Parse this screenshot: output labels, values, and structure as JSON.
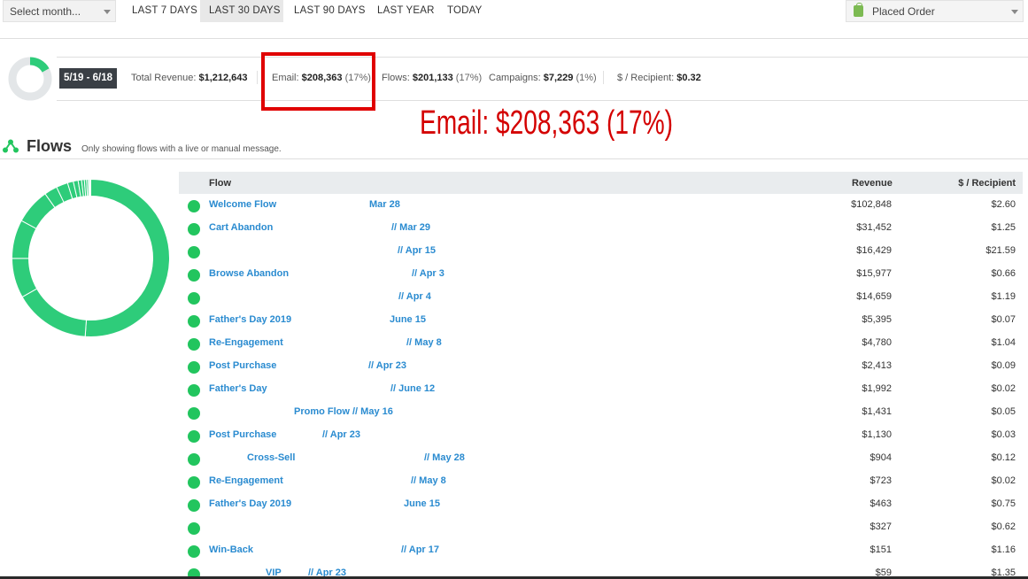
{
  "toolbar": {
    "month_select": "Select month...",
    "ranges": [
      "LAST 7 DAYS",
      "LAST 30 DAYS",
      "LAST 90 DAYS",
      "LAST YEAR",
      "TODAY"
    ],
    "active_range": "LAST 30 DAYS",
    "metric_select": "Placed Order"
  },
  "summary": {
    "date_range": "5/19 - 6/18",
    "total_revenue_label": "Total Revenue:",
    "total_revenue": "$1,212,643",
    "email_label": "Email:",
    "email_value": "$208,363",
    "email_pct": "(17%)",
    "flows_label": "Flows:",
    "flows_value": "$201,133",
    "flows_pct": "(17%)",
    "campaigns_label": "Campaigns:",
    "campaigns_value": "$7,229",
    "campaigns_pct": "(1%)",
    "per_recipient_label": "$ / Recipient:",
    "per_recipient_value": "$0.32",
    "email_share_fraction": 0.17
  },
  "annotation": {
    "text": "Email: $208,363 (17%)",
    "color": "#d40000"
  },
  "flows": {
    "title": "Flows",
    "subtitle": "Only showing flows with a live or manual message.",
    "columns": {
      "flow": "Flow",
      "revenue": "Revenue",
      "per_recipient": "$ / Recipient"
    },
    "accent": "#22c55e",
    "link_color": "#2a8bd0",
    "rows": [
      {
        "name": "Welcome Flow",
        "date": "Mar 28",
        "revenue": "$102,848",
        "per_recipient": "$2.60"
      },
      {
        "name": "Cart Abandon",
        "date": "// Mar 29",
        "revenue": "$31,452",
        "per_recipient": "$1.25"
      },
      {
        "name": "",
        "date": "// Apr 15",
        "revenue": "$16,429",
        "per_recipient": "$21.59"
      },
      {
        "name": "Browse Abandon",
        "date": "// Apr 3",
        "revenue": "$15,977",
        "per_recipient": "$0.66"
      },
      {
        "name": "",
        "date": "// Apr 4",
        "revenue": "$14,659",
        "per_recipient": "$1.19"
      },
      {
        "name": "Father's Day 2019",
        "date": "June 15",
        "revenue": "$5,395",
        "per_recipient": "$0.07"
      },
      {
        "name": "Re-Engagement",
        "date": "// May 8",
        "revenue": "$4,780",
        "per_recipient": "$1.04"
      },
      {
        "name": "Post Purchase",
        "date": "// Apr 23",
        "revenue": "$2,413",
        "per_recipient": "$0.09"
      },
      {
        "name": "Father's Day",
        "date": "// June 12",
        "revenue": "$1,992",
        "per_recipient": "$0.02"
      },
      {
        "name": "",
        "date": "Promo Flow // May 16",
        "revenue": "$1,431",
        "per_recipient": "$0.05"
      },
      {
        "name": "Post Purchase",
        "date": "// Apr 23",
        "revenue": "$1,130",
        "per_recipient": "$0.03"
      },
      {
        "name": "Cross-Sell",
        "date": "// May 28",
        "revenue": "$904",
        "per_recipient": "$0.12"
      },
      {
        "name": "Re-Engagement",
        "date": "// May 8",
        "revenue": "$723",
        "per_recipient": "$0.02"
      },
      {
        "name": "Father's Day 2019",
        "date": "June 15",
        "revenue": "$463",
        "per_recipient": "$0.75"
      },
      {
        "name": "",
        "date": "",
        "revenue": "$327",
        "per_recipient": "$0.62"
      },
      {
        "name": "Win-Back",
        "date": "// Apr 17",
        "revenue": "$151",
        "per_recipient": "$1.16"
      },
      {
        "name": "VIP",
        "date": "// Apr 23",
        "revenue": "$59",
        "per_recipient": "$1.35"
      }
    ]
  },
  "chart_data": {
    "type": "pie",
    "categories": [
      "Welcome Flow",
      "Cart Abandon",
      "",
      "Browse Abandon",
      "",
      "Father's Day 2019",
      "Re-Engagement",
      "Post Purchase",
      "Father's Day",
      "Promo Flow",
      "Post Purchase",
      "Cross-Sell",
      "Re-Engagement",
      "Father's Day 2019",
      "",
      "Win-Back",
      "VIP"
    ],
    "values": [
      102848,
      31452,
      16429,
      15977,
      14659,
      5395,
      4780,
      2413,
      1992,
      1431,
      1130,
      904,
      723,
      463,
      327,
      151,
      59
    ],
    "colors": [
      "#2ecc7a"
    ],
    "title": ""
  }
}
